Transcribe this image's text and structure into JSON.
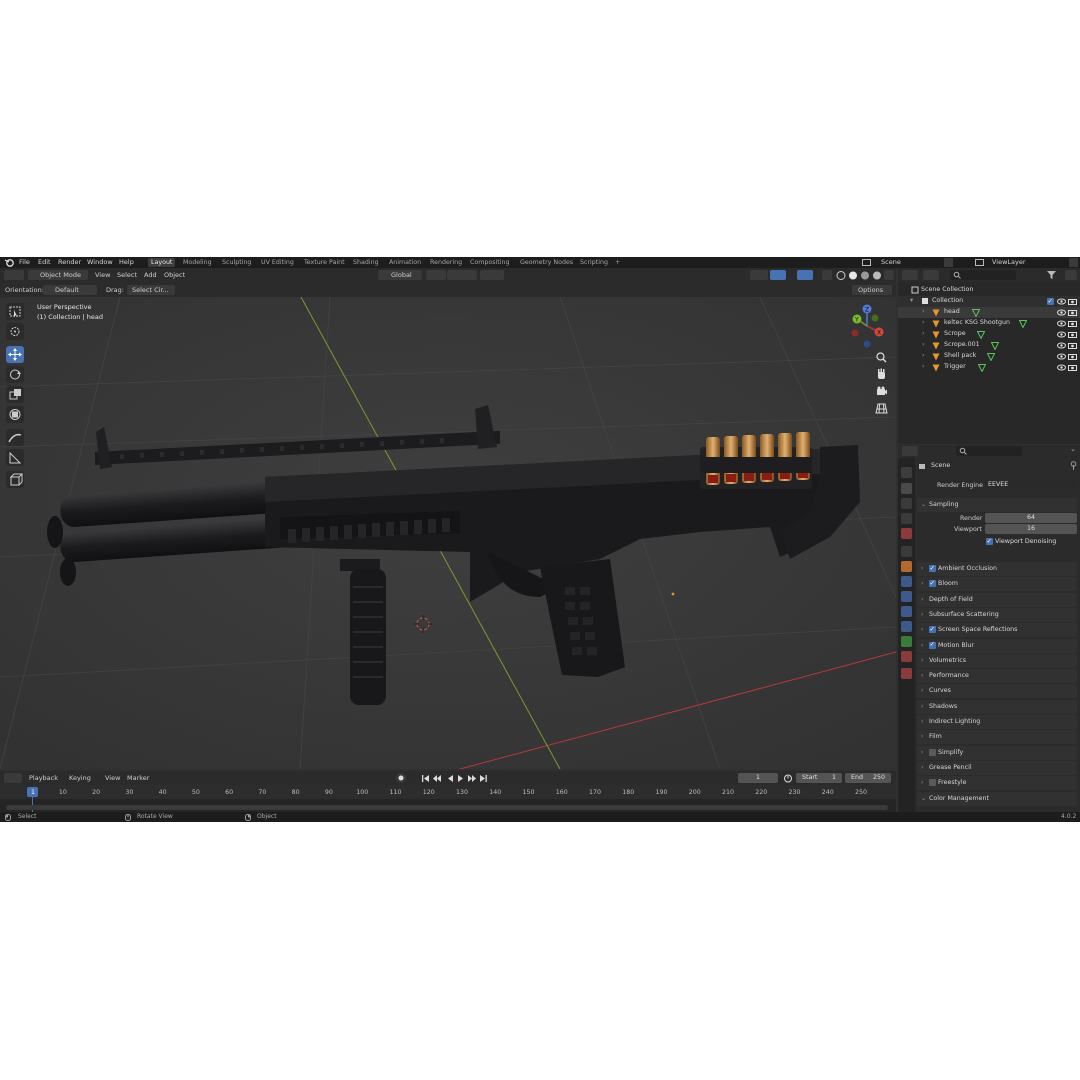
{
  "menu": [
    "File",
    "Edit",
    "Render",
    "Window",
    "Help"
  ],
  "workspaces": [
    "Layout",
    "Modeling",
    "Sculpting",
    "UV Editing",
    "Texture Paint",
    "Shading",
    "Animation",
    "Rendering",
    "Compositing",
    "Geometry Nodes",
    "Scripting"
  ],
  "workspace_add": "+",
  "scene_name": "Scene",
  "view_layer": "ViewLayer",
  "viewport_header": {
    "mode": "Object Mode",
    "menus": [
      "View",
      "Select",
      "Add",
      "Object"
    ],
    "transform_orientation": "Global"
  },
  "tool_settings": {
    "orientation_label": "Orientation:",
    "orientation_value": "Default",
    "drag_label": "Drag:",
    "drag_value": "Select Cir...",
    "options": "Options"
  },
  "viewport_info": {
    "line1": "User Perspective",
    "line2": "(1) Collection | head"
  },
  "outliner": {
    "root": "Scene Collection",
    "collection": "Collection",
    "items": [
      "head",
      "keltec KSG Shootgun",
      "Scrope",
      "Scrope.001",
      "Shell pack",
      "Trigger"
    ]
  },
  "properties": {
    "breadcrumb": "Scene",
    "render_engine_label": "Render Engine",
    "render_engine_value": "EEVEE",
    "sampling": {
      "title": "Sampling",
      "render_label": "Render",
      "render_value": "64",
      "viewport_label": "Viewport",
      "viewport_value": "16",
      "denoise_label": "Viewport Denoising"
    },
    "panels": [
      {
        "label": "Ambient Occlusion",
        "checkbox": true,
        "checked": true
      },
      {
        "label": "Bloom",
        "checkbox": true,
        "checked": true
      },
      {
        "label": "Depth of Field",
        "checkbox": false,
        "checked": false
      },
      {
        "label": "Subsurface Scattering",
        "checkbox": false,
        "checked": false
      },
      {
        "label": "Screen Space Reflections",
        "checkbox": true,
        "checked": true
      },
      {
        "label": "Motion Blur",
        "checkbox": true,
        "checked": true
      },
      {
        "label": "Volumetrics",
        "checkbox": false,
        "checked": false
      },
      {
        "label": "Performance",
        "checkbox": false,
        "checked": false
      },
      {
        "label": "Curves",
        "checkbox": false,
        "checked": false
      },
      {
        "label": "Shadows",
        "checkbox": false,
        "checked": false
      },
      {
        "label": "Indirect Lighting",
        "checkbox": false,
        "checked": false
      },
      {
        "label": "Film",
        "checkbox": false,
        "checked": false
      },
      {
        "label": "Simplify",
        "checkbox": true,
        "checked": false
      },
      {
        "label": "Grease Pencil",
        "checkbox": false,
        "checked": false
      },
      {
        "label": "Freestyle",
        "checkbox": true,
        "checked": false
      },
      {
        "label": "Color Management",
        "checkbox": false,
        "checked": false
      }
    ]
  },
  "timeline": {
    "menus": [
      "Playback",
      "Keying",
      "View",
      "Marker"
    ],
    "current_frame": "1",
    "start_label": "Start",
    "start_value": "1",
    "end_label": "End",
    "end_value": "250",
    "ticks": [
      "1",
      "10",
      "20",
      "30",
      "40",
      "50",
      "60",
      "70",
      "80",
      "90",
      "100",
      "110",
      "120",
      "130",
      "140",
      "150",
      "160",
      "170",
      "180",
      "190",
      "200",
      "210",
      "220",
      "230",
      "240",
      "250"
    ]
  },
  "status_bar": {
    "select": "Select",
    "rotate": "Rotate View",
    "object": "Object",
    "version": "4.0.2"
  },
  "colors": {
    "accent": "#4772b3",
    "object_orange": "#e8962e",
    "mesh_green": "#59c35c",
    "axis_red": "#b33a3a",
    "axis_green": "#7a9a2e"
  },
  "icons": [
    "blender-logo-icon",
    "select-box-icon",
    "cursor-icon",
    "move-icon",
    "rotate-icon",
    "scale-icon",
    "transform-icon",
    "annotate-icon",
    "measure-icon",
    "add-cube-icon",
    "zoom-icon",
    "hand-icon",
    "camera-icon",
    "grid-icon",
    "eye-icon",
    "camera-render-icon",
    "filter-icon",
    "pin-icon"
  ]
}
